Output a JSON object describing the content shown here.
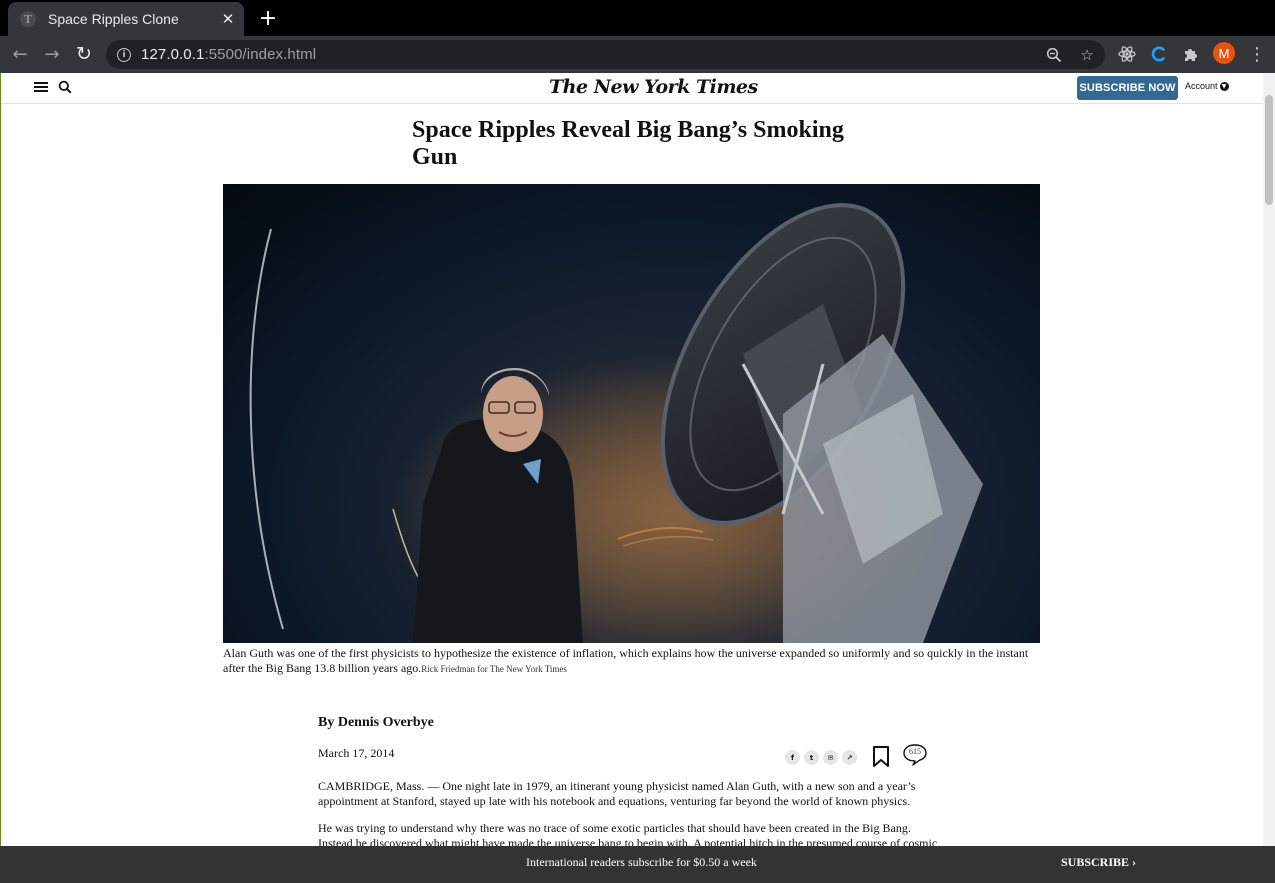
{
  "browser": {
    "tab_title": "Space Ripples Clone",
    "tab_close": "✕",
    "new_tab": "+",
    "url_host": "127.0.0.1",
    "url_path": ":5500/index.html",
    "profile_initial": "M",
    "icons": [
      "back-icon",
      "forward-icon",
      "reload-icon",
      "site-info-icon",
      "zoom-out-icon",
      "bookmark-star-icon",
      "react-devtools-icon",
      "extension-c-icon",
      "puzzle-extensions-icon",
      "profile-avatar",
      "kebab-menu-icon"
    ]
  },
  "masthead": {
    "logo": "The New York Times",
    "subscribe_label": "SUBSCRIBE NOW",
    "account_label": "Account"
  },
  "article": {
    "headline": "Space Ripples Reveal Big Bang’s Smoking Gun",
    "caption": "Alan Guth was one of the first physicists to hypothesize the existence of inflation, which explains how the universe expanded so uniformly and so quickly in the instant after the Big Bang 13.8 billion years ago.",
    "credit": "Rick Friedman for The New York Times",
    "byline": "By Dennis Overbye",
    "date": "March 17, 2014",
    "comment_count": "615",
    "share_icons": [
      "f",
      "t",
      "✉",
      "↗"
    ],
    "paragraphs": [
      "CAMBRIDGE, Mass. — One night late in 1979, an itinerant young physicist named Alan Guth, with a new son and a year’s appointment at Stanford, stayed up late with his notebook and equations, venturing far beyond the world of known physics.",
      "He was trying to understand why there was no trace of some exotic particles that should have been created in the Big Bang. Instead he discovered what might have made the universe bang to begin with. A potential hitch in the presumed course of cosmic"
    ]
  },
  "banner": {
    "text": "International readers subscribe for $0.50 a week",
    "cta": "SUBSCRIBE ›"
  },
  "colors": {
    "subscribe_button": "#326891",
    "banner_background": "#333333",
    "profile_avatar": "#e8530f"
  }
}
